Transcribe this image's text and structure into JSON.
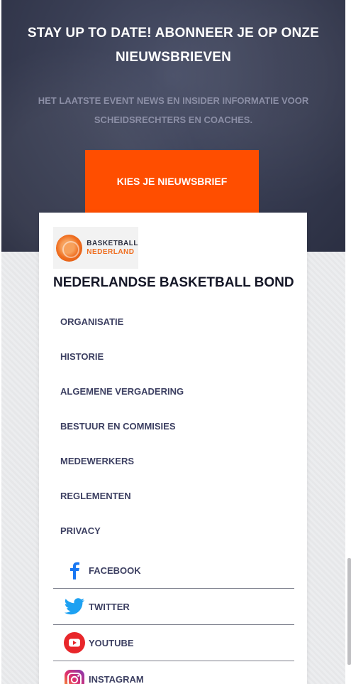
{
  "newsletter": {
    "title": "STAY UP TO DATE! ABONNEER JE OP ONZE NIEUWSBRIEVEN",
    "subtitle": "HET LAATSTE EVENT NEWS EN INSIDER INFORMATIE VOOR SCHEIDSRECHTERS EN COACHES.",
    "cta_label": "KIES JE NIEUWSBRIEF"
  },
  "brand": {
    "logo_line1": "BASKETBALL",
    "logo_line2": "NEDERLAND",
    "org_name": "NEDERLANDSE BASKETBALL BOND"
  },
  "menu": {
    "items": [
      {
        "label": "ORGANISATIE"
      },
      {
        "label": "HISTORIE"
      },
      {
        "label": "ALGEMENE VERGADERING"
      },
      {
        "label": "BESTUUR EN COMMISIES"
      },
      {
        "label": "MEDEWERKERS"
      },
      {
        "label": "REGLEMENTEN"
      },
      {
        "label": "PRIVACY"
      }
    ]
  },
  "social": {
    "items": [
      {
        "label": "FACEBOOK",
        "icon": "facebook-icon"
      },
      {
        "label": "TWITTER",
        "icon": "twitter-icon"
      },
      {
        "label": "YOUTUBE",
        "icon": "youtube-icon"
      },
      {
        "label": "INSTAGRAM",
        "icon": "instagram-icon"
      }
    ]
  },
  "colors": {
    "accent": "#ff4e00",
    "hero_bg": "#3a3f55",
    "menu_text": "#3d4062",
    "facebook": "#1877f2",
    "twitter": "#1da1f2",
    "youtube": "#ff0000"
  }
}
